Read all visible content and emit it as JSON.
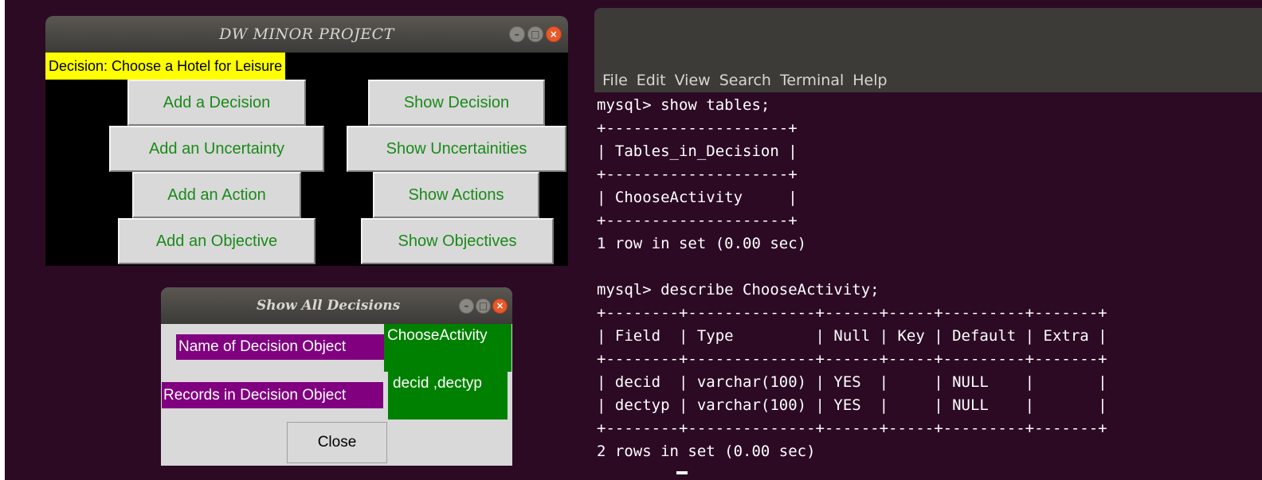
{
  "main_window": {
    "title": "DW MINOR PROJECT",
    "decision_label": "Decision: Choose a Hotel for Leisure",
    "buttons": {
      "add_decision": "Add a Decision",
      "show_decision": "Show Decision",
      "add_uncertainty": "Add an Uncertainty",
      "show_uncertainties": "Show Uncertainities",
      "add_action": "Add an Action",
      "show_actions": "Show Actions",
      "add_objective": "Add an Objective",
      "show_objectives": "Show Objectives"
    }
  },
  "dialog": {
    "title": "Show All Decisions",
    "name_label": "Name of Decision Object",
    "name_value": "ChooseActivity",
    "records_label": "Records in Decision Object",
    "records_value": "decid ,dectyp",
    "close_label": "Close"
  },
  "terminal": {
    "menu": [
      "File",
      "Edit",
      "View",
      "Search",
      "Terminal",
      "Help"
    ],
    "output": "mysql> show tables;\n+--------------------+\n| Tables_in_Decision |\n+--------------------+\n| ChooseActivity     |\n+--------------------+\n1 row in set (0.00 sec)\n\nmysql> describe ChooseActivity;\n+--------+--------------+------+-----+---------+-------+\n| Field  | Type         | Null | Key | Default | Extra |\n+--------+--------------+------+-----+---------+-------+\n| decid  | varchar(100) | YES  |     | NULL    |       |\n| dectyp | varchar(100) | YES  |     | NULL    |       |\n+--------+--------------+------+-----+---------+-------+\n2 rows in set (0.00 sec)"
  },
  "colors": {
    "desktop": "#2c0a24",
    "titlebar": "#3c3b37",
    "button_text": "#1a8a1a",
    "label_bg": "#ffff00",
    "purple": "#800080",
    "green": "#008000",
    "close_icon": "#e8592a"
  }
}
